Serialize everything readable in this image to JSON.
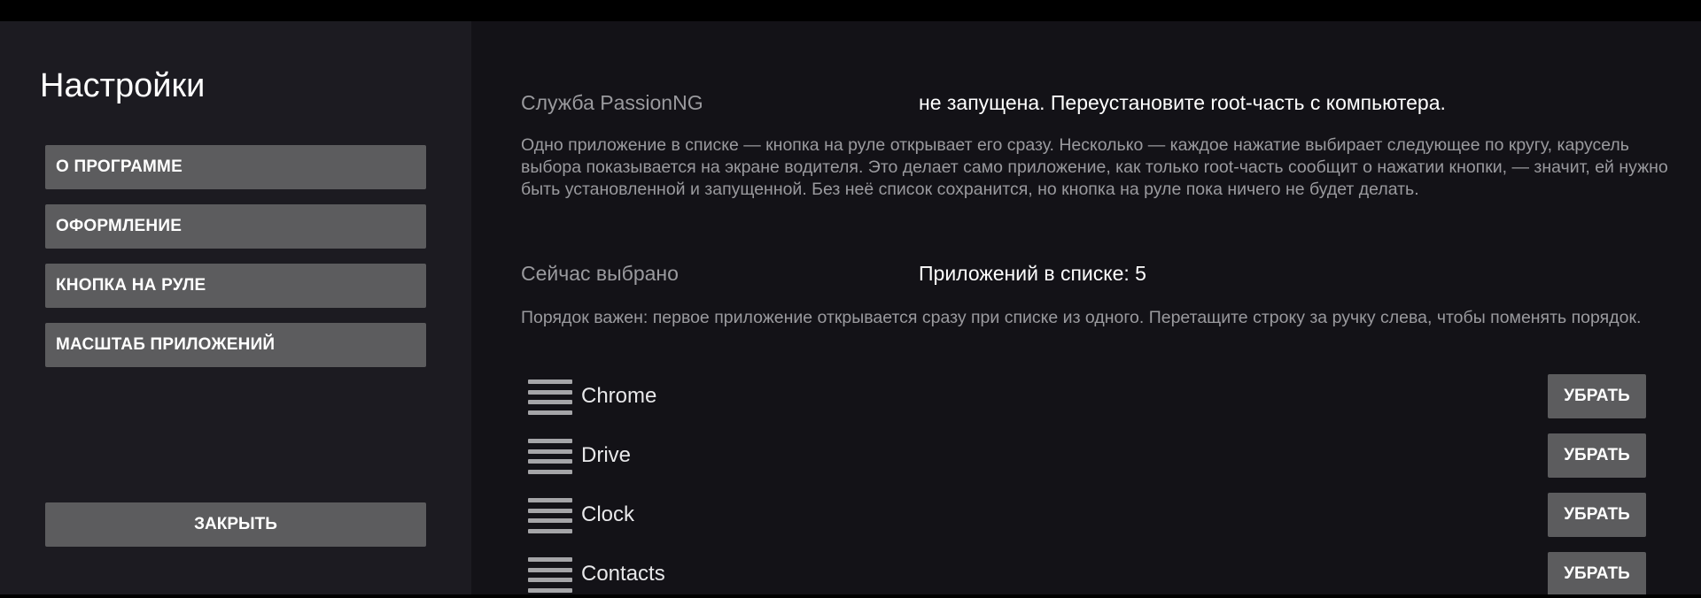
{
  "sidebar": {
    "title": "Настройки",
    "items": [
      {
        "label": "О ПРОГРАММЕ"
      },
      {
        "label": "ОФОРМЛЕНИЕ"
      },
      {
        "label": "КНОПКА НА РУЛЕ"
      },
      {
        "label": "МАСШТАБ ПРИЛОЖЕНИЙ"
      }
    ],
    "close_label": "ЗАКРЫТЬ"
  },
  "main": {
    "service": {
      "label": "Служба PassionNG",
      "status": "не запущена. Переустановите root-часть с компьютера.",
      "description": "Одно приложение в списке — кнопка на руле открывает его сразу. Несколько — каждое нажатие выбирает следующее по кругу, карусель выбора показывается на экране водителя. Это делает само приложение, как только root-часть сообщит о нажатии кнопки, — значит, ей нужно быть установленной и запущенной. Без неё список сохранится, но кнопка на руле пока ничего не будет делать."
    },
    "selected": {
      "label": "Сейчас выбрано",
      "value": "Приложений в списке: 5",
      "description": "Порядок важен: первое приложение открывается сразу при списке из одного. Перетащите строку за ручку слева, чтобы поменять порядок."
    },
    "apps": [
      {
        "name": "Chrome",
        "remove_label": "УБРАТЬ"
      },
      {
        "name": "Drive",
        "remove_label": "УБРАТЬ"
      },
      {
        "name": "Clock",
        "remove_label": "УБРАТЬ"
      },
      {
        "name": "Contacts",
        "remove_label": "УБРАТЬ"
      }
    ]
  }
}
